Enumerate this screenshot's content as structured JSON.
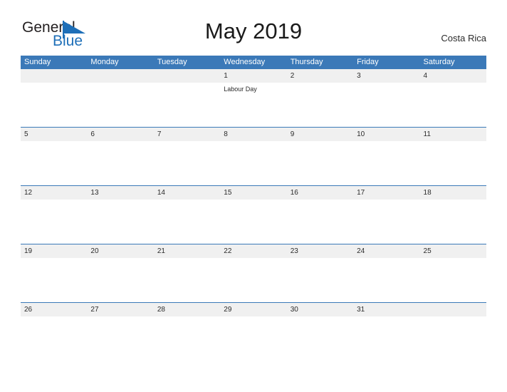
{
  "brand": {
    "name_part1": "General",
    "name_part2": "Blue",
    "flag_icon": "blue-triangle-flag-icon",
    "accent_color": "#1e6fb8"
  },
  "header": {
    "title": "May 2019",
    "region": "Costa Rica"
  },
  "calendar": {
    "header_bg": "#3b79b8",
    "row_band_bg": "#f0f0f0",
    "weekday_headers": [
      "Sunday",
      "Monday",
      "Tuesday",
      "Wednesday",
      "Thursday",
      "Friday",
      "Saturday"
    ],
    "weeks": [
      {
        "days": [
          {
            "date": "",
            "events": []
          },
          {
            "date": "",
            "events": []
          },
          {
            "date": "",
            "events": []
          },
          {
            "date": "1",
            "events": [
              "Labour Day"
            ]
          },
          {
            "date": "2",
            "events": []
          },
          {
            "date": "3",
            "events": []
          },
          {
            "date": "4",
            "events": []
          }
        ]
      },
      {
        "days": [
          {
            "date": "5",
            "events": []
          },
          {
            "date": "6",
            "events": []
          },
          {
            "date": "7",
            "events": []
          },
          {
            "date": "8",
            "events": []
          },
          {
            "date": "9",
            "events": []
          },
          {
            "date": "10",
            "events": []
          },
          {
            "date": "11",
            "events": []
          }
        ]
      },
      {
        "days": [
          {
            "date": "12",
            "events": []
          },
          {
            "date": "13",
            "events": []
          },
          {
            "date": "14",
            "events": []
          },
          {
            "date": "15",
            "events": []
          },
          {
            "date": "16",
            "events": []
          },
          {
            "date": "17",
            "events": []
          },
          {
            "date": "18",
            "events": []
          }
        ]
      },
      {
        "days": [
          {
            "date": "19",
            "events": []
          },
          {
            "date": "20",
            "events": []
          },
          {
            "date": "21",
            "events": []
          },
          {
            "date": "22",
            "events": []
          },
          {
            "date": "23",
            "events": []
          },
          {
            "date": "24",
            "events": []
          },
          {
            "date": "25",
            "events": []
          }
        ]
      },
      {
        "days": [
          {
            "date": "26",
            "events": []
          },
          {
            "date": "27",
            "events": []
          },
          {
            "date": "28",
            "events": []
          },
          {
            "date": "29",
            "events": []
          },
          {
            "date": "30",
            "events": []
          },
          {
            "date": "31",
            "events": []
          },
          {
            "date": "",
            "events": []
          }
        ]
      }
    ]
  }
}
